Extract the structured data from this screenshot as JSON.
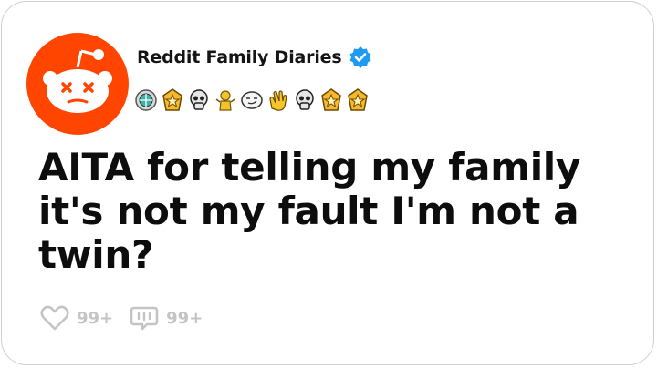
{
  "post": {
    "channel_name": "Reddit Family Diaries",
    "title": "AITA for telling my family it's not my fault I'm not a twin?",
    "likes": "99+",
    "comments": "99+"
  },
  "awards": [
    "globe-award-icon",
    "star-award-icon",
    "skull-award-icon",
    "gold-figure-award-icon",
    "smirk-award-icon",
    "clap-award-icon",
    "skull-award-icon",
    "star-award-icon",
    "star-award-icon"
  ],
  "colors": {
    "brand": "#ff4500",
    "verified": "#1d9bf0",
    "muted": "#c4c4c4"
  }
}
